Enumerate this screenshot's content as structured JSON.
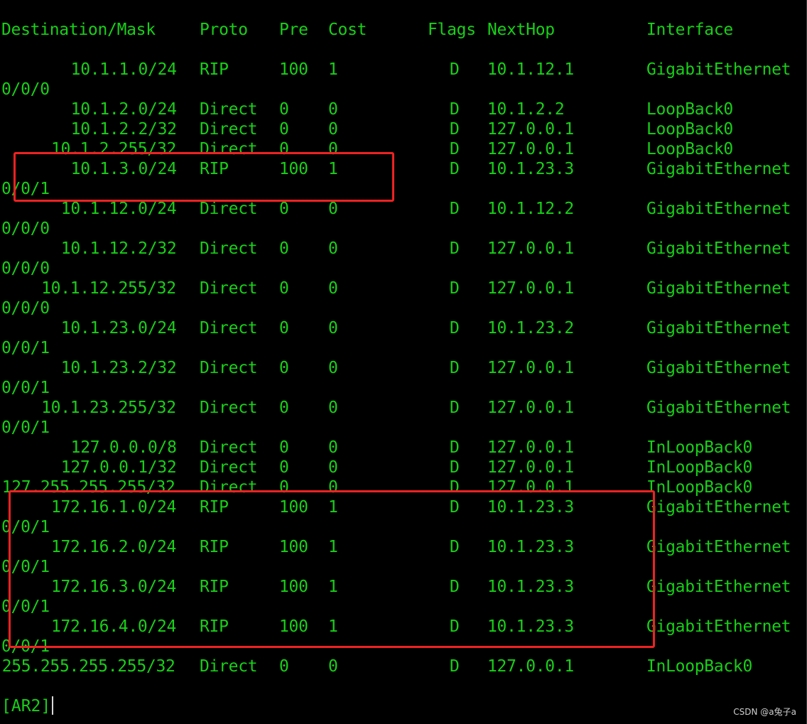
{
  "colors": {
    "background": "#000000",
    "text": "#18d018",
    "highlight_box": "#ee2222",
    "cursor": "#d8d8d8",
    "watermark": "#cfcfcf"
  },
  "header": {
    "destination_mask": "Destination/Mask",
    "proto": "Proto",
    "pre": "Pre",
    "cost": "Cost",
    "flags": "Flags",
    "nexthop": "NextHop",
    "interface": "Interface"
  },
  "lines": [
    {
      "dest": "       10.1.1.0/24",
      "proto": "RIP",
      "pre": "100",
      "cost": "1",
      "flags": "D",
      "nexthop": "10.1.12.1",
      "iface": "GigabitEthernet"
    },
    {
      "wrap": "0/0/0"
    },
    {
      "dest": "       10.1.2.0/24",
      "proto": "Direct",
      "pre": "0",
      "cost": "0",
      "flags": "D",
      "nexthop": "10.1.2.2",
      "iface": "LoopBack0"
    },
    {
      "dest": "       10.1.2.2/32",
      "proto": "Direct",
      "pre": "0",
      "cost": "0",
      "flags": "D",
      "nexthop": "127.0.0.1",
      "iface": "LoopBack0"
    },
    {
      "dest": "     10.1.2.255/32",
      "proto": "Direct",
      "pre": "0",
      "cost": "0",
      "flags": "D",
      "nexthop": "127.0.0.1",
      "iface": "LoopBack0"
    },
    {
      "dest": "       10.1.3.0/24",
      "proto": "RIP",
      "pre": "100",
      "cost": "1",
      "flags": "D",
      "nexthop": "10.1.23.3",
      "iface": "GigabitEthernet"
    },
    {
      "wrap": "0/0/1"
    },
    {
      "dest": "      10.1.12.0/24",
      "proto": "Direct",
      "pre": "0",
      "cost": "0",
      "flags": "D",
      "nexthop": "10.1.12.2",
      "iface": "GigabitEthernet"
    },
    {
      "wrap": "0/0/0"
    },
    {
      "dest": "      10.1.12.2/32",
      "proto": "Direct",
      "pre": "0",
      "cost": "0",
      "flags": "D",
      "nexthop": "127.0.0.1",
      "iface": "GigabitEthernet"
    },
    {
      "wrap": "0/0/0"
    },
    {
      "dest": "    10.1.12.255/32",
      "proto": "Direct",
      "pre": "0",
      "cost": "0",
      "flags": "D",
      "nexthop": "127.0.0.1",
      "iface": "GigabitEthernet"
    },
    {
      "wrap": "0/0/0"
    },
    {
      "dest": "      10.1.23.0/24",
      "proto": "Direct",
      "pre": "0",
      "cost": "0",
      "flags": "D",
      "nexthop": "10.1.23.2",
      "iface": "GigabitEthernet"
    },
    {
      "wrap": "0/0/1"
    },
    {
      "dest": "      10.1.23.2/32",
      "proto": "Direct",
      "pre": "0",
      "cost": "0",
      "flags": "D",
      "nexthop": "127.0.0.1",
      "iface": "GigabitEthernet"
    },
    {
      "wrap": "0/0/1"
    },
    {
      "dest": "    10.1.23.255/32",
      "proto": "Direct",
      "pre": "0",
      "cost": "0",
      "flags": "D",
      "nexthop": "127.0.0.1",
      "iface": "GigabitEthernet"
    },
    {
      "wrap": "0/0/1"
    },
    {
      "dest": "      127.0.0.0/8",
      "proto": "Direct",
      "pre": "0",
      "cost": "0",
      "flags": "D",
      "nexthop": "127.0.0.1",
      "iface": "InLoopBack0"
    },
    {
      "dest": "      127.0.0.1/32",
      "proto": "Direct",
      "pre": "0",
      "cost": "0",
      "flags": "D",
      "nexthop": "127.0.0.1",
      "iface": "InLoopBack0"
    },
    {
      "dest": "127.255.255.255/32",
      "proto": "Direct",
      "pre": "0",
      "cost": "0",
      "flags": "D",
      "nexthop": "127.0.0.1",
      "iface": "InLoopBack0"
    },
    {
      "dest": "     172.16.1.0/24",
      "proto": "RIP",
      "pre": "100",
      "cost": "1",
      "flags": "D",
      "nexthop": "10.1.23.3",
      "iface": "GigabitEthernet"
    },
    {
      "wrap": "0/0/1"
    },
    {
      "dest": "     172.16.2.0/24",
      "proto": "RIP",
      "pre": "100",
      "cost": "1",
      "flags": "D",
      "nexthop": "10.1.23.3",
      "iface": "GigabitEthernet"
    },
    {
      "wrap": "0/0/1"
    },
    {
      "dest": "     172.16.3.0/24",
      "proto": "RIP",
      "pre": "100",
      "cost": "1",
      "flags": "D",
      "nexthop": "10.1.23.3",
      "iface": "GigabitEthernet"
    },
    {
      "wrap": "0/0/1"
    },
    {
      "dest": "     172.16.4.0/24",
      "proto": "RIP",
      "pre": "100",
      "cost": "1",
      "flags": "D",
      "nexthop": "10.1.23.3",
      "iface": "GigabitEthernet"
    },
    {
      "wrap": "0/0/1"
    },
    {
      "dest": "255.255.255.255/32",
      "proto": "Direct",
      "pre": "0",
      "cost": "0",
      "flags": "D",
      "nexthop": "127.0.0.1",
      "iface": "InLoopBack0"
    }
  ],
  "prompt": "[AR2]",
  "watermark": "CSDN @a兔子a"
}
